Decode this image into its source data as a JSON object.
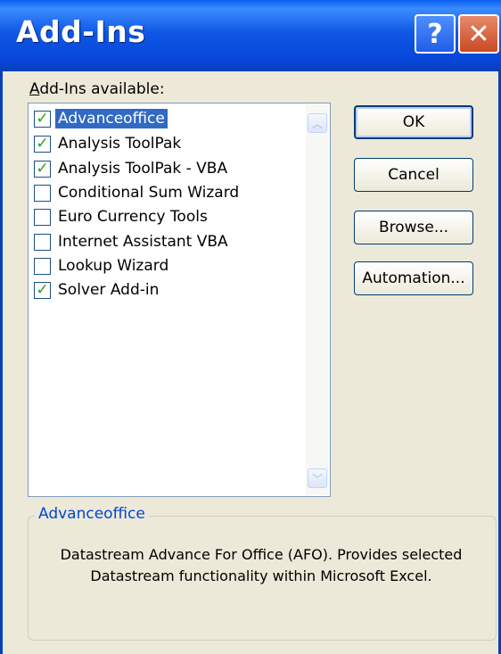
{
  "window": {
    "title": "Add-Ins"
  },
  "titlebar": {
    "help_label": "?",
    "close_label": "✕"
  },
  "list": {
    "label": "Add-Ins available:",
    "items": [
      {
        "label": "Advanceoffice",
        "checked": true,
        "selected": true,
        "mark": "✓"
      },
      {
        "label": "Analysis ToolPak",
        "checked": true,
        "mark": "✓"
      },
      {
        "label": "Analysis ToolPak - VBA",
        "checked": true,
        "mark": "✓"
      },
      {
        "label": "Conditional Sum Wizard",
        "checked": false,
        "mark": ""
      },
      {
        "label": "Euro Currency Tools",
        "checked": false,
        "mark": ""
      },
      {
        "label": "Internet Assistant VBA",
        "checked": false,
        "mark": ""
      },
      {
        "label": "Lookup Wizard",
        "checked": false,
        "mark": ""
      },
      {
        "label": "Solver Add-in",
        "checked": true,
        "mark": "✓"
      }
    ]
  },
  "buttons": {
    "ok": "OK",
    "cancel": "Cancel",
    "browse": "Browse...",
    "automation": "Automation..."
  },
  "details": {
    "title": "Advanceoffice",
    "description": "Datastream Advance For Office (AFO). Provides selected Datastream functionality within Microsoft Excel."
  },
  "colors": {
    "title_bar": "#0a5ff0",
    "selection": "#316ac5",
    "check": "#21a121",
    "group_title": "#0046d5"
  }
}
